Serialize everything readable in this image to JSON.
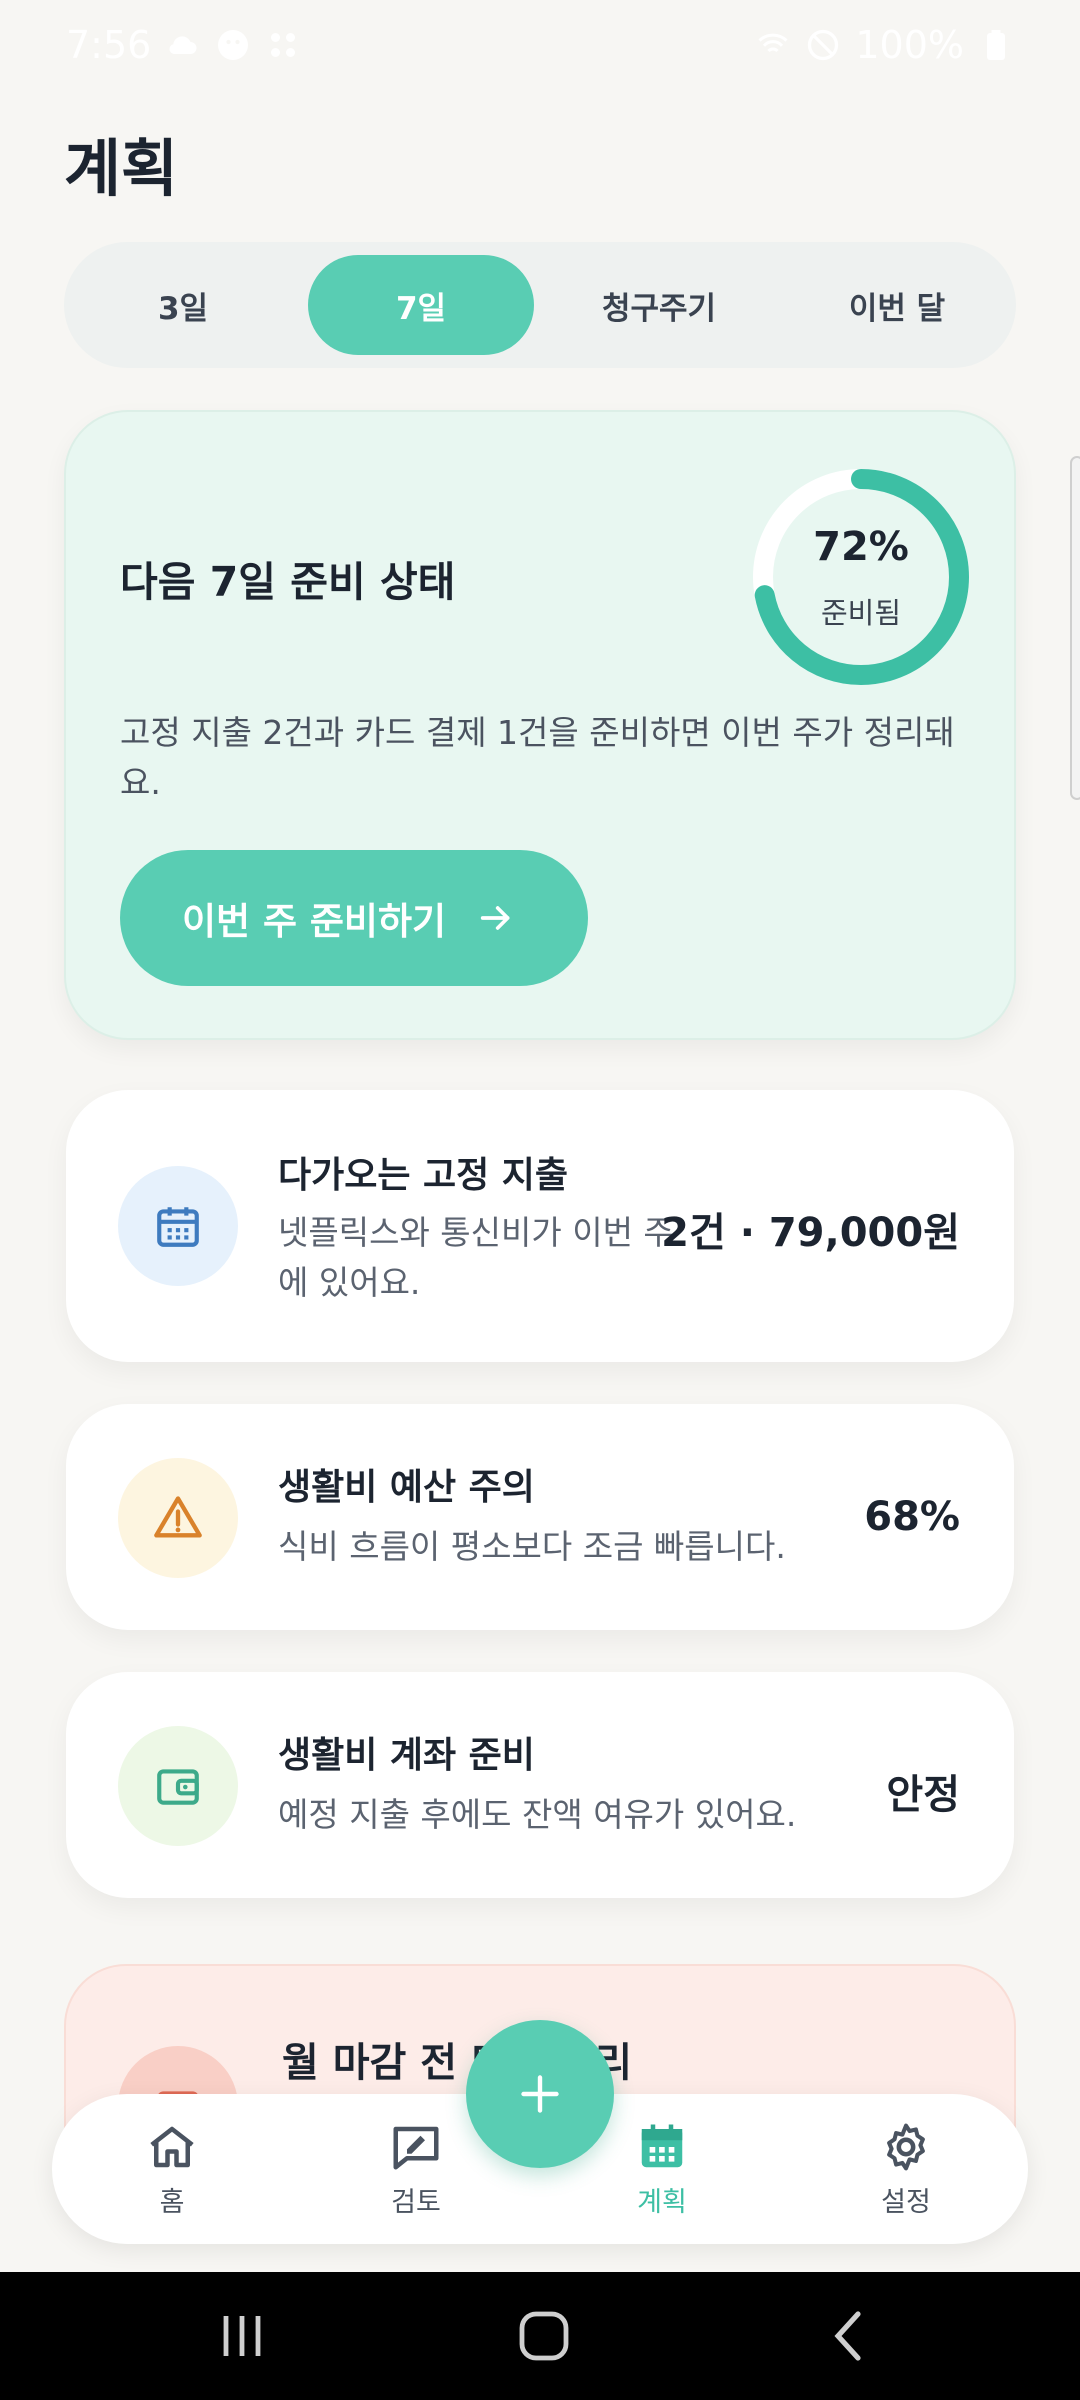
{
  "status_bar": {
    "time": "7:56",
    "battery": "100%"
  },
  "page": {
    "title": "계획"
  },
  "tabs": [
    {
      "label": "3일",
      "active": false
    },
    {
      "label": "7일",
      "active": true
    },
    {
      "label": "청구주기",
      "active": false
    },
    {
      "label": "이번 달",
      "active": false
    }
  ],
  "hero": {
    "title": "다음 7일 준비 상태",
    "progress_percent": 72,
    "progress_text": "72%",
    "progress_label": "준비됨",
    "description": "고정 지출 2건과 카드 결제 1건을 준비하면 이번 주가 정리돼요.",
    "button_label": "이번 주 준비하기"
  },
  "cards": [
    {
      "icon": "calendar-icon",
      "title": "다가오는 고정 지출",
      "description": "넷플릭스와 통신비가 이번 주에 있어요.",
      "value": "2건 · 79,000원"
    },
    {
      "icon": "warning-icon",
      "title": "생활비 예산 주의",
      "description": "식비 흐름이 평소보다 조금 빠릅니다.",
      "value": "68%"
    },
    {
      "icon": "wallet-icon",
      "title": "생활비 계좌 준비",
      "description": "예정 지출 후에도 잔액 여유가 있어요.",
      "value": "안정"
    },
    {
      "icon": "card-icon",
      "title": "월 마감 전 미리 정리"
    }
  ],
  "bottom_nav": [
    {
      "label": "홈",
      "icon": "home-icon",
      "active": false
    },
    {
      "label": "검토",
      "icon": "review-icon",
      "active": false
    },
    {
      "label": "계획",
      "icon": "calendar-icon",
      "active": true
    },
    {
      "label": "설정",
      "icon": "gear-icon",
      "active": false
    }
  ],
  "colors": {
    "accent": "#59cdb3",
    "hero_bg": "#e8f7f1",
    "warning": "#d9822b",
    "calendar_blue": "#3e7bbf",
    "wallet_green": "#3daa8a"
  }
}
